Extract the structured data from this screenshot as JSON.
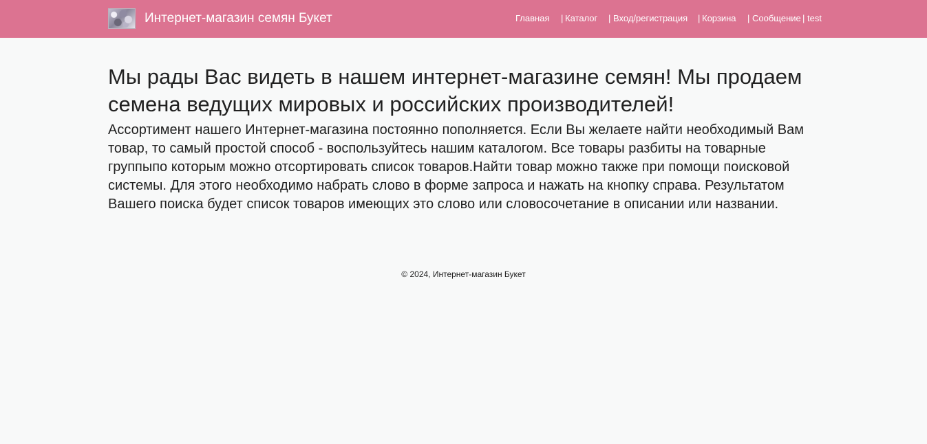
{
  "header": {
    "brand_title": "Интернет-магазин семян Букет",
    "logo_icon": "flower-logo-icon",
    "background_color": "#dc7391",
    "nav": {
      "home": "Главная",
      "catalog": "Каталог",
      "login": "Вход/регистрация",
      "cart": "Корзина",
      "messages": "Сообщение",
      "user": "test",
      "separator": "|"
    }
  },
  "main": {
    "welcome_heading": "Мы рады Вас видеть в нашем интернет-магазине семян! Мы продаем семена ведущих мировых и российских производителей!",
    "about_text": "Ассортимент нашего Интернет-магазина постоянно пополняется. Если Вы желаете найти необходимый Вам товар, то самый простой способ - воспользуйтесь нашим каталогом. Все товары разбиты на товарные группыпо которым можно отсортировать список товаров.Найти товар можно также при помощи поисковой системы. Для этого необходимо набрать слово в форме запроса и нажать на кнопку справа. Результатом Вашего поиска будет список товаров имеющих это слово или словосочетание в описании или названии."
  },
  "footer": {
    "copyright": "© 2024, Интернет-магазин Букет"
  }
}
